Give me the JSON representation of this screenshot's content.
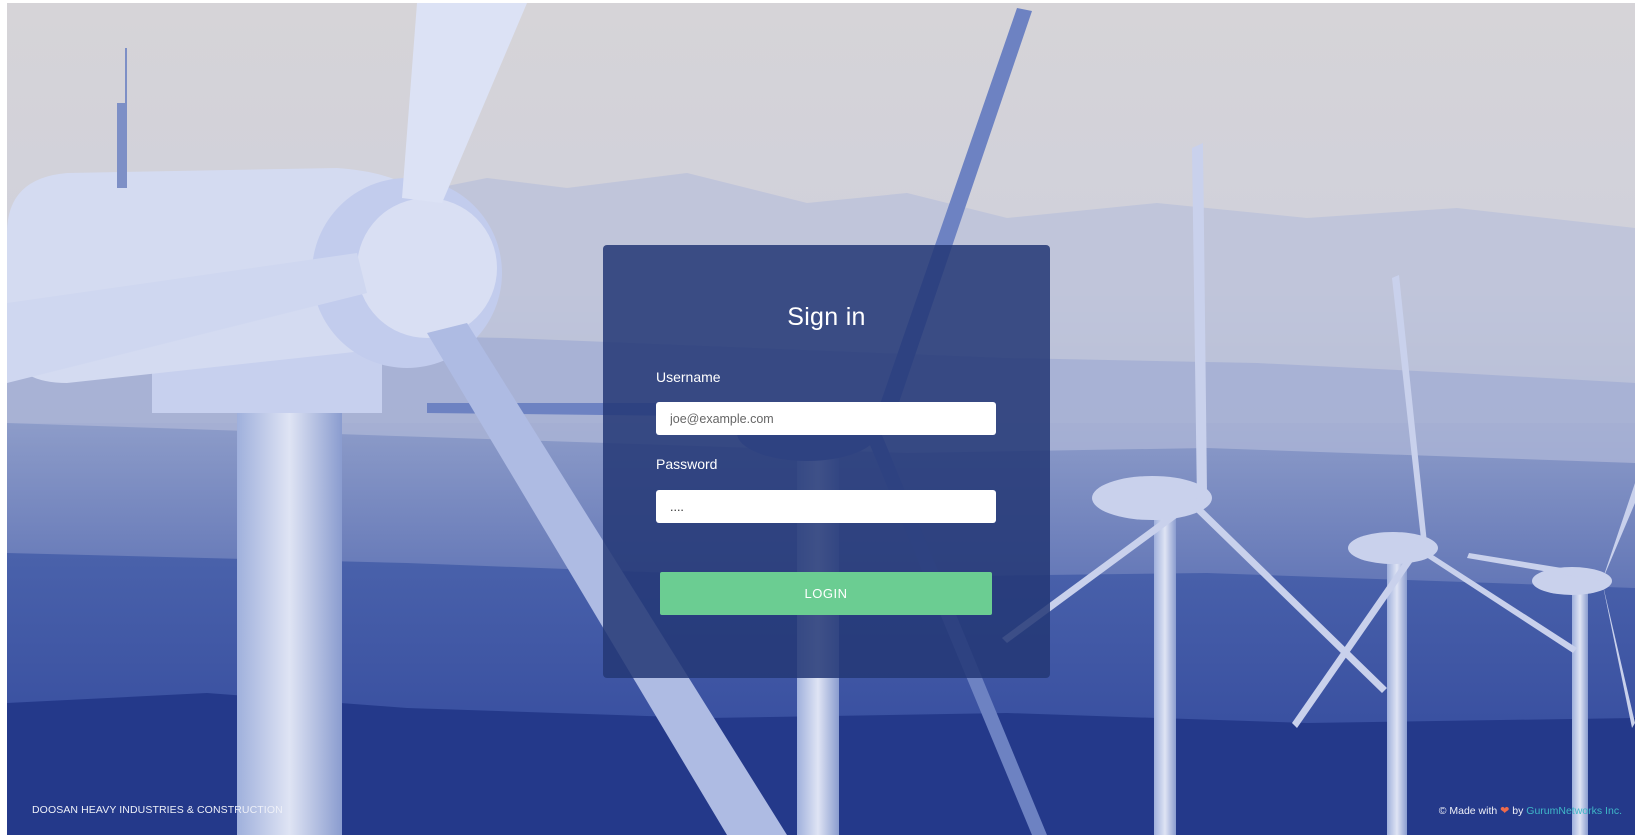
{
  "login": {
    "title": "Sign in",
    "username_label": "Username",
    "username_placeholder": "joe@example.com",
    "username_value": "",
    "password_label": "Password",
    "password_value": "....",
    "login_button_label": "LOGIN"
  },
  "footer": {
    "company": "DOOSAN HEAVY INDUSTRIES & CONSTRUCTION",
    "made_with": "© Made with",
    "heart": "❤",
    "by": "by",
    "author": "GurumNetworks Inc."
  },
  "colors": {
    "card": "#243876",
    "button": "#6bcd92",
    "link": "#3fb8c8",
    "heart": "#ef6a4a"
  },
  "background": {
    "icon": "wind-turbines-photo"
  }
}
